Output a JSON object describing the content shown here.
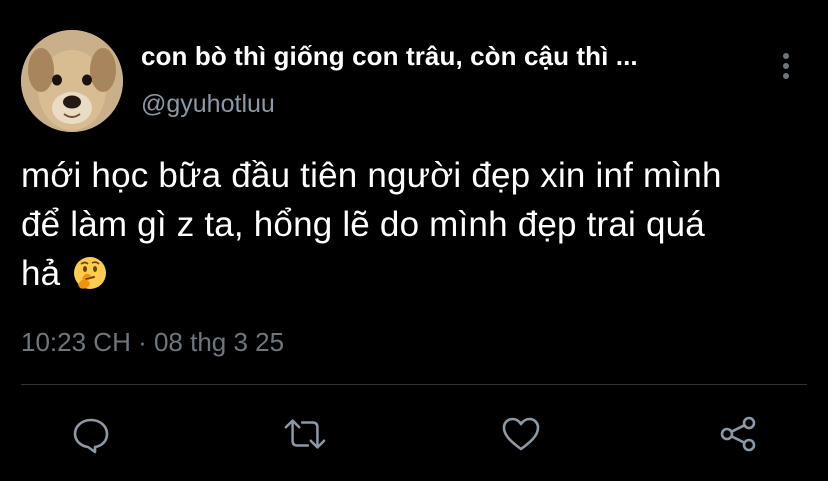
{
  "tweet": {
    "display_name": "con bò thì giống con trâu, còn cậu thì ...",
    "handle": "@gyuhotluu",
    "text_line1": "mới học bữa đầu tiên người đẹp xin inf mình",
    "text_line2": "để làm gì z ta, hổng lẽ do mình đẹp trai quá",
    "text_line3": "hả",
    "emoji": "thinking-face",
    "timestamp": "10:23 CH · 08 thg 3 25"
  },
  "icons": {
    "more": "more-vertical-icon",
    "reply": "reply-icon",
    "retweet": "retweet-icon",
    "like": "heart-icon",
    "share": "share-icon"
  },
  "colors": {
    "background": "#000000",
    "primary_text": "#ffffff",
    "secondary_text": "#8b98a5",
    "icon": "#8b98a5",
    "divider": "#2f3336"
  }
}
